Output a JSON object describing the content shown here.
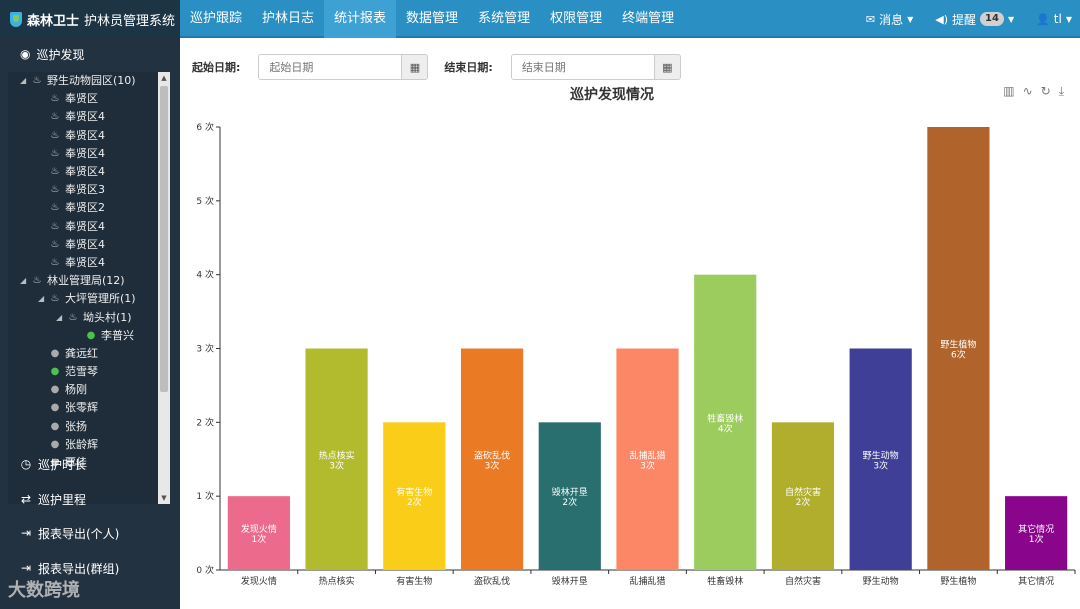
{
  "app": {
    "brand_bold": "森林卫士",
    "brand_name": "护林员管理系统"
  },
  "nav": {
    "items": [
      "巡护跟踪",
      "护林日志",
      "统计报表",
      "数据管理",
      "系统管理",
      "权限管理",
      "终端管理"
    ],
    "active_index": 2
  },
  "topright": {
    "message_icon": "envelope-icon",
    "message_label": "消息",
    "alert_icon": "volume-icon",
    "alert_label": "提醒",
    "alert_count": "14",
    "user_icon": "user-icon",
    "user_label": "tl"
  },
  "sidebar": {
    "section_title": "巡护发现",
    "section_icon": "eye-icon",
    "tree": [
      {
        "label": "野生动物园区(10)",
        "level": 0,
        "icon": "fire-icon",
        "expanded": true
      },
      {
        "label": "奉贤区",
        "level": 1,
        "icon": "fire-icon"
      },
      {
        "label": "奉贤区4",
        "level": 1,
        "icon": "fire-icon"
      },
      {
        "label": "奉贤区4",
        "level": 1,
        "icon": "fire-icon"
      },
      {
        "label": "奉贤区4",
        "level": 1,
        "icon": "fire-icon"
      },
      {
        "label": "奉贤区4",
        "level": 1,
        "icon": "fire-icon"
      },
      {
        "label": "奉贤区3",
        "level": 1,
        "icon": "fire-icon"
      },
      {
        "label": "奉贤区2",
        "level": 1,
        "icon": "fire-icon"
      },
      {
        "label": "奉贤区4",
        "level": 1,
        "icon": "fire-icon"
      },
      {
        "label": "奉贤区4",
        "level": 1,
        "icon": "fire-icon"
      },
      {
        "label": "奉贤区4",
        "level": 1,
        "icon": "fire-icon"
      },
      {
        "label": "林业管理局(12)",
        "level": 0,
        "icon": "fire-icon",
        "expanded": true
      },
      {
        "label": "大坪管理所(1)",
        "level": 1,
        "icon": "fire-icon",
        "expanded": true
      },
      {
        "label": "坳头村(1)",
        "level": 2,
        "icon": "fire-icon",
        "expanded": true
      },
      {
        "label": "李普兴",
        "level": 3,
        "icon": "user-green-icon"
      },
      {
        "label": "龚远红",
        "level": 1,
        "icon": "user-icon"
      },
      {
        "label": "范雪琴",
        "level": 1,
        "icon": "user-green-icon"
      },
      {
        "label": "杨刚",
        "level": 1,
        "icon": "user-icon"
      },
      {
        "label": "张零辉",
        "level": 1,
        "icon": "user-icon"
      },
      {
        "label": "张扬",
        "level": 1,
        "icon": "user-icon"
      },
      {
        "label": "张龄辉",
        "level": 1,
        "icon": "user-icon"
      },
      {
        "label": "覃佳",
        "level": 1,
        "icon": "user-icon"
      }
    ],
    "menus": [
      {
        "label": "巡护时长",
        "icon": "clock-icon"
      },
      {
        "label": "巡护里程",
        "icon": "retweet-icon"
      },
      {
        "label": "报表导出(个人)",
        "icon": "export-icon"
      },
      {
        "label": "报表导出(群组)",
        "icon": "export-icon"
      }
    ]
  },
  "filters": {
    "start_label": "起始日期:",
    "start_placeholder": "起始日期",
    "end_label": "结束日期:",
    "end_placeholder": "结束日期"
  },
  "watermark": "大数跨境",
  "chart_data": {
    "type": "bar",
    "title": "巡护发现情况",
    "categories": [
      "发现火情",
      "热点核实",
      "有害生物",
      "盗砍乱伐",
      "毁林开垦",
      "乱捕乱猎",
      "牲畜毁林",
      "自然灾害",
      "野生动物",
      "野生植物",
      "其它情况"
    ],
    "values": [
      1,
      3,
      2,
      3,
      2,
      3,
      4,
      2,
      3,
      6,
      1
    ],
    "value_labels": [
      "1次",
      "3次",
      "2次",
      "3次",
      "2次",
      "3次",
      "4次",
      "2次",
      "3次",
      "6次",
      "1次"
    ],
    "colors": [
      "#ec6a8c",
      "#b2bb2e",
      "#f9cd18",
      "#ea7a24",
      "#2a6f6f",
      "#fb8766",
      "#9ccc5e",
      "#b0ae2c",
      "#3f3f97",
      "#b0632a",
      "#88058c"
    ],
    "yticks": [
      "0 次",
      "1 次",
      "2 次",
      "3 次",
      "4 次",
      "5 次",
      "6 次"
    ],
    "ylim": [
      0,
      6
    ],
    "grid": false,
    "toolbox": [
      "bar-chart-icon",
      "line-chart-icon",
      "refresh-icon",
      "download-icon"
    ]
  }
}
